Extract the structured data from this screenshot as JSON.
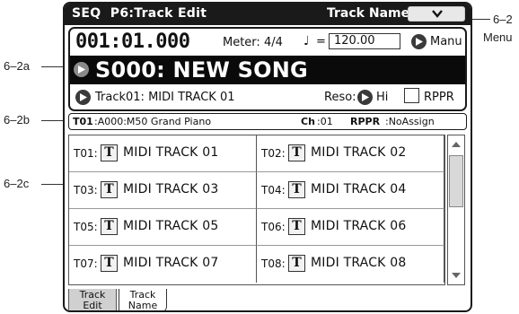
{
  "header": {
    "page_title": "SEQ  P6:Track Edit",
    "tab_title": "Track Name"
  },
  "info": {
    "location": "001:01.000",
    "meter": "Meter: 4/4",
    "tempo_note": "♩",
    "tempo_eq": "=",
    "tempo": "120.00",
    "tempo_mode": "Manu",
    "song": "S000: NEW SONG",
    "track": "Track01: MIDI TRACK 01",
    "reso_label": "Reso:",
    "reso_value": "Hi",
    "rppr_label": "RPPR",
    "rppr_checked": false
  },
  "track_info": {
    "track": "T01",
    "program": ":A000:M50 Grand Piano",
    "ch_label": "Ch",
    "ch_value": ":01",
    "rppr_label": "RPPR",
    "rppr_value": ":NoAssign"
  },
  "tracks": [
    {
      "id": "T01:",
      "button": "T",
      "name": "MIDI TRACK 01"
    },
    {
      "id": "T02:",
      "button": "T",
      "name": "MIDI TRACK 02"
    },
    {
      "id": "T03:",
      "button": "T",
      "name": "MIDI TRACK 03"
    },
    {
      "id": "T04:",
      "button": "T",
      "name": "MIDI TRACK 04"
    },
    {
      "id": "T05:",
      "button": "T",
      "name": "MIDI TRACK 05"
    },
    {
      "id": "T06:",
      "button": "T",
      "name": "MIDI TRACK 06"
    },
    {
      "id": "T07:",
      "button": "T",
      "name": "MIDI TRACK 07"
    },
    {
      "id": "T08:",
      "button": "T",
      "name": "MIDI TRACK 08"
    }
  ],
  "bottom_tabs": [
    {
      "line1": "Track",
      "line2": "Edit"
    },
    {
      "line1": "Track",
      "line2": "Name"
    }
  ],
  "callouts": {
    "menu_num": "6–2",
    "menu_text": "Menu",
    "a": "6–2a",
    "b": "6–2b",
    "c": "6–2c"
  },
  "icons": {
    "menu": "chevron-down-icon",
    "arrow": "triangle-right-icon",
    "scroll_up": "triangle-up-icon",
    "scroll_down": "triangle-down-icon"
  }
}
